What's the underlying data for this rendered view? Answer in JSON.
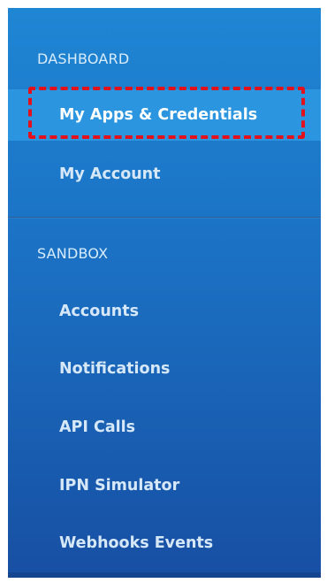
{
  "sidebar": {
    "dashboard_title": "DASHBOARD",
    "dashboard_items": [
      {
        "label": "My Apps & Credentials",
        "active": true
      },
      {
        "label": "My Account",
        "active": false
      }
    ],
    "sandbox_title": "SANDBOX",
    "sandbox_items": [
      {
        "label": "Accounts"
      },
      {
        "label": "Notifications"
      },
      {
        "label": "API Calls"
      },
      {
        "label": "IPN Simulator"
      },
      {
        "label": "Webhooks Events"
      }
    ]
  },
  "colors": {
    "panel_top": "#1f86d4",
    "panel_bottom": "#174fa3",
    "active_item_bg": "#2b95e0",
    "highlight_border": "#e3111b"
  }
}
